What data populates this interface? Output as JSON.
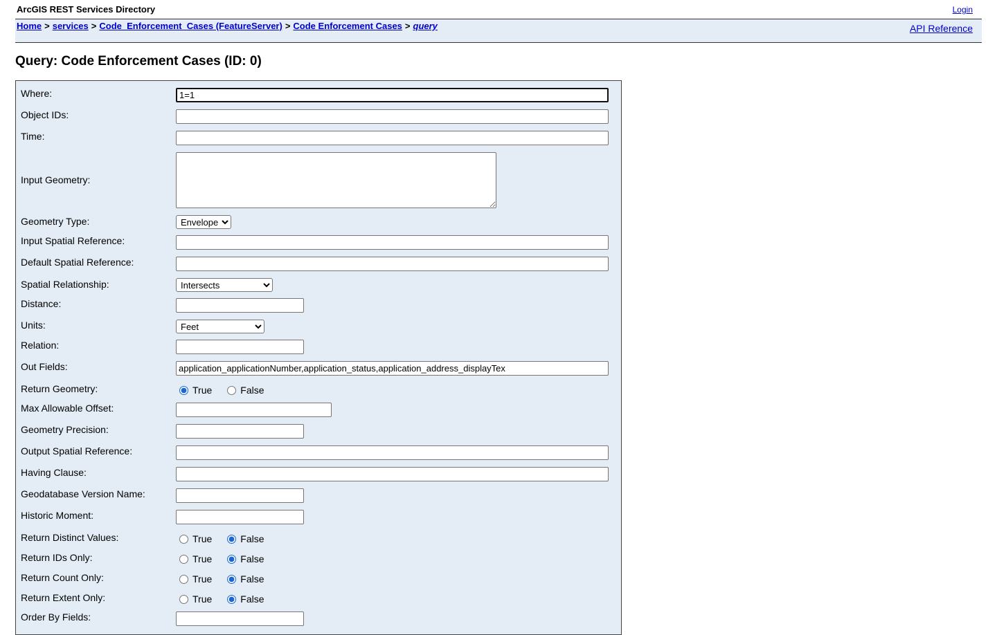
{
  "header": {
    "app_title": "ArcGIS REST Services Directory",
    "login_label": "Login"
  },
  "breadcrumb": {
    "home": "Home",
    "services": "services",
    "feature_server": "Code_Enforcement_Cases (FeatureServer)",
    "layer": "Code Enforcement Cases",
    "current": "query",
    "separator": ">"
  },
  "api_reference_label": "API Reference",
  "page_title": "Query: Code Enforcement Cases (ID: 0)",
  "form": {
    "where": {
      "label": "Where:",
      "value": "1=1"
    },
    "object_ids": {
      "label": "Object IDs:",
      "value": ""
    },
    "time": {
      "label": "Time:",
      "value": ""
    },
    "input_geometry": {
      "label": "Input Geometry:",
      "value": ""
    },
    "geometry_type": {
      "label": "Geometry Type:",
      "selected": "Envelope"
    },
    "input_sr": {
      "label": "Input Spatial Reference:",
      "value": ""
    },
    "default_sr": {
      "label": "Default Spatial Reference:",
      "value": ""
    },
    "spatial_rel": {
      "label": "Spatial Relationship:",
      "selected": "Intersects"
    },
    "distance": {
      "label": "Distance:",
      "value": ""
    },
    "units": {
      "label": "Units:",
      "selected": "Feet"
    },
    "relation": {
      "label": "Relation:",
      "value": ""
    },
    "out_fields": {
      "label": "Out Fields:",
      "value": "application_applicationNumber,application_status,application_address_displayTex"
    },
    "return_geometry": {
      "label": "Return Geometry:",
      "value": true
    },
    "max_offset": {
      "label": "Max Allowable Offset:",
      "value": ""
    },
    "geometry_precision": {
      "label": "Geometry Precision:",
      "value": ""
    },
    "output_sr": {
      "label": "Output Spatial Reference:",
      "value": ""
    },
    "having_clause": {
      "label": "Having Clause:",
      "value": ""
    },
    "gdb_version": {
      "label": "Geodatabase Version Name:",
      "value": ""
    },
    "historic_moment": {
      "label": "Historic Moment:",
      "value": ""
    },
    "return_distinct": {
      "label": "Return Distinct Values:",
      "value": false
    },
    "return_ids_only": {
      "label": "Return IDs Only:",
      "value": false
    },
    "return_count_only": {
      "label": "Return Count Only:",
      "value": false
    },
    "return_extent_only": {
      "label": "Return Extent Only:",
      "value": false
    },
    "order_by": {
      "label": "Order By Fields:",
      "value": ""
    },
    "true_label": "True",
    "false_label": "False"
  },
  "colors": {
    "panel_bg": "#e4edf6",
    "link": "#0000cc",
    "radio_accent": "#1a66d2"
  }
}
